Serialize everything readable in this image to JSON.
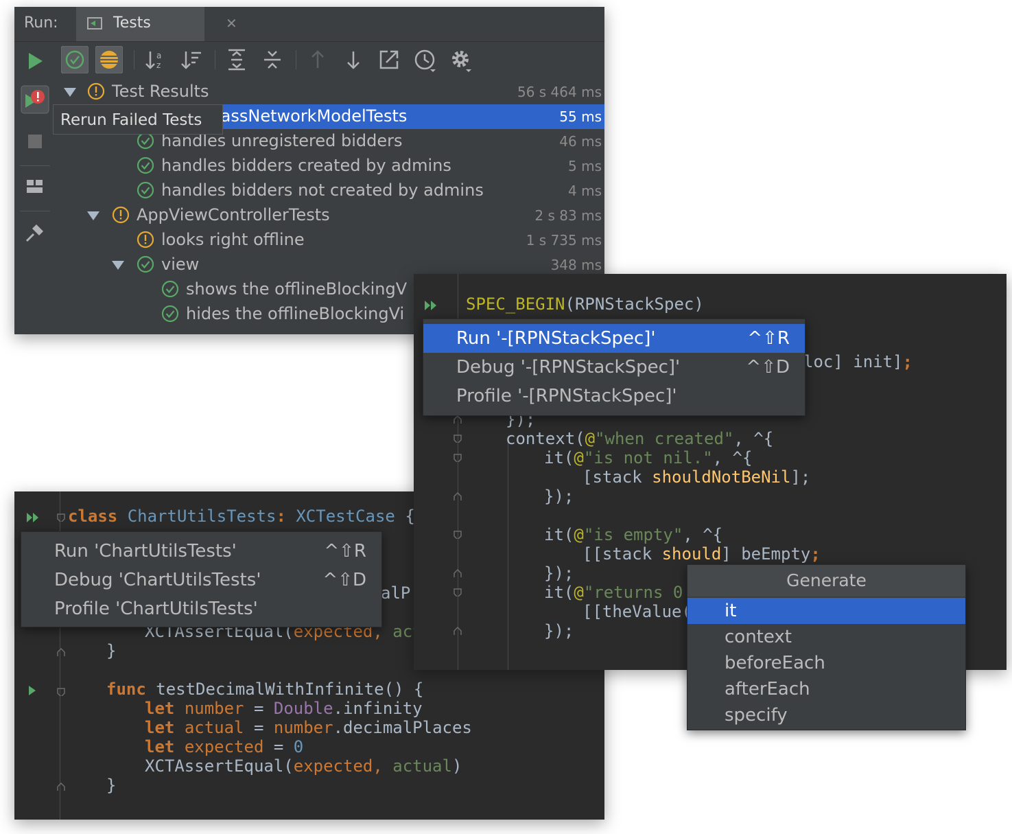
{
  "run_panel": {
    "run_label": "Run:",
    "tab_label": "Tests",
    "tooltip": "Rerun Failed Tests",
    "tree": [
      {
        "label": "Test Results",
        "time": "56 s 464 ms"
      },
      {
        "label": "CBypassNetworkModelTests",
        "time": "55 ms"
      },
      {
        "label": "handles unregistered bidders",
        "time": "46 ms"
      },
      {
        "label": "handles bidders created by admins",
        "time": "5 ms"
      },
      {
        "label": "handles bidders not created by admins",
        "time": "4 ms"
      },
      {
        "label": "AppViewControllerTests",
        "time": "2 s 83 ms"
      },
      {
        "label": "looks right offline",
        "time": "1 s 735 ms"
      },
      {
        "label": "view",
        "time": "348 ms"
      },
      {
        "label": "shows the offlineBlockingV",
        "time": ""
      },
      {
        "label": "hides the offlineBlockingVi",
        "time": ""
      }
    ],
    "colors": {
      "pass": "#59a869",
      "warn": "#e5a934",
      "fail": "#d64848",
      "selection": "#2f65ca"
    }
  },
  "spec_panel": {
    "spec_begin": "SPEC_BEGIN",
    "spec_name": "(RPNStackSpec)",
    "alloc_tail": "loc] init]",
    "close_block": "});",
    "context_call": "context(",
    "at": "@",
    "when_created": "\"when created\"",
    "block_open": ", ^{",
    "it_call": "it(",
    "is_not_nil": "\"is not nil.\"",
    "stack_open": "[stack ",
    "should_not_be_nil": "shouldNotBeNil",
    "close_bracket_semi": "];",
    "is_empty": "\"is empty\"",
    "stack_should": "[[stack ",
    "should": "should",
    "be_empty": "] beEmpty",
    "returns_0": "\"returns 0",
    "the_value": "[[theValue(",
    "menu": [
      {
        "label": "Run '-[RPNStackSpec]'",
        "shortcut": "^⇧R"
      },
      {
        "label": "Debug '-[RPNStackSpec]'",
        "shortcut": "^⇧D"
      },
      {
        "label": "Profile '-[RPNStackSpec]'",
        "shortcut": ""
      }
    ]
  },
  "generate_menu": {
    "title": "Generate",
    "items": [
      "it",
      "context",
      "beforeEach",
      "afterEach",
      "specify"
    ]
  },
  "swift_panel": {
    "kw_class": "class",
    "class_name": "ChartUtilsTests",
    "colon": ":",
    "superclass": "XCTestCase",
    "open_brace": "{",
    "close_brace": "}",
    "partial_1": "alP",
    "xct_assert": "XCTAssertEqual(",
    "expected": "expected",
    "comma": ", ",
    "act_partial": "act",
    "actual_word": "actual",
    "close_paren": ")",
    "kw_func": "func",
    "func_name": "testDecimalWithInfinite() {",
    "kw_let": "let",
    "number": "number",
    "eq": " = ",
    "double": "Double",
    "infinity": ".infinity",
    "decimal_places": ".decimalPlaces",
    "zero": "0",
    "menu": [
      {
        "label": "Run 'ChartUtilsTests'",
        "shortcut": "^⇧R"
      },
      {
        "label": "Debug 'ChartUtilsTests'",
        "shortcut": "^⇧D"
      },
      {
        "label": "Profile 'ChartUtilsTests'",
        "shortcut": ""
      }
    ]
  }
}
